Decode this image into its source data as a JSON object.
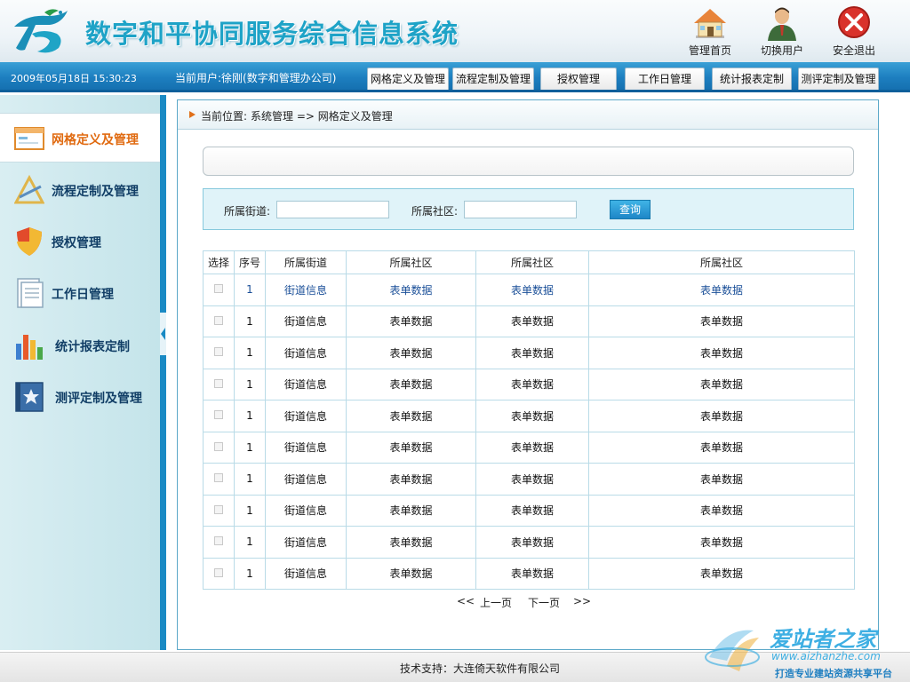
{
  "header": {
    "title": "数字和平协同服务综合信息系统",
    "buttons": [
      {
        "label": "管理首页",
        "icon": "home-icon"
      },
      {
        "label": "切换用户",
        "icon": "user-switch-icon"
      },
      {
        "label": "安全退出",
        "icon": "exit-icon"
      }
    ]
  },
  "navbar": {
    "datetime": "2009年05月18日 15:30:23",
    "current_user": "当前用户:徐刚(数字和管理办公司)",
    "tabs": [
      "网格定义及管理",
      "流程定制及管理",
      "授权管理",
      "工作日管理",
      "统计报表定制",
      "测评定制及管理"
    ],
    "active_tab": "网格定义及管理"
  },
  "sidebar": {
    "items": [
      {
        "label": "网格定义及管理",
        "icon": "grid-window-icon"
      },
      {
        "label": "流程定制及管理",
        "icon": "triangle-tool-icon"
      },
      {
        "label": "授权管理",
        "icon": "shield-icon"
      },
      {
        "label": "工作日管理",
        "icon": "document-icon"
      },
      {
        "label": "统计报表定制",
        "icon": "bar-chart-icon"
      },
      {
        "label": "测评定制及管理",
        "icon": "star-book-icon"
      }
    ],
    "active_item": "网格定义及管理"
  },
  "breadcrumb": {
    "prefix": "当前位置:",
    "path": "系统管理 => 网格定义及管理"
  },
  "search": {
    "street_label": "所属街道:",
    "street_value": "",
    "community_label": "所属社区:",
    "community_value": "",
    "query_button": "查询"
  },
  "table": {
    "headers": [
      "选择",
      "序号",
      "所属街道",
      "所属社区",
      "所属社区",
      "所属社区"
    ],
    "rows": [
      [
        "",
        "1",
        "街道信息",
        "表单数据",
        "表单数据",
        "表单数据"
      ],
      [
        "",
        "1",
        "街道信息",
        "表单数据",
        "表单数据",
        "表单数据"
      ],
      [
        "",
        "1",
        "街道信息",
        "表单数据",
        "表单数据",
        "表单数据"
      ],
      [
        "",
        "1",
        "街道信息",
        "表单数据",
        "表单数据",
        "表单数据"
      ],
      [
        "",
        "1",
        "街道信息",
        "表单数据",
        "表单数据",
        "表单数据"
      ],
      [
        "",
        "1",
        "街道信息",
        "表单数据",
        "表单数据",
        "表单数据"
      ],
      [
        "",
        "1",
        "街道信息",
        "表单数据",
        "表单数据",
        "表单数据"
      ],
      [
        "",
        "1",
        "街道信息",
        "表单数据",
        "表单数据",
        "表单数据"
      ],
      [
        "",
        "1",
        "街道信息",
        "表单数据",
        "表单数据",
        "表单数据"
      ],
      [
        "",
        "1",
        "街道信息",
        "表单数据",
        "表单数据",
        "表单数据"
      ]
    ]
  },
  "pager": {
    "first": "<<",
    "prev": "上一页",
    "next": "下一页",
    "last": ">>"
  },
  "footer": {
    "text": "技术支持：大连倚天软件有限公司"
  },
  "watermark": {
    "title": "爱站者之家",
    "url": "www.aizhanzhe.com",
    "slogan": "打造专业建站资源共享平台"
  },
  "colors": {
    "title": "#1ea3c7",
    "navbar": "#1d7fc0",
    "active_side_label": "#e06a10",
    "link": "#1a4f98"
  }
}
